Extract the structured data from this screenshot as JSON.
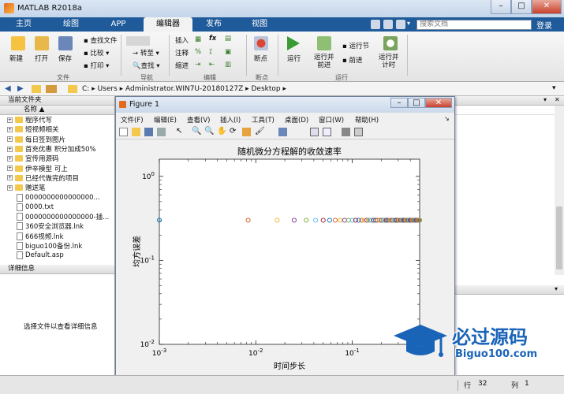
{
  "window": {
    "title": "MATLAB R2018a",
    "min": "–",
    "max": "□",
    "close": "✕"
  },
  "tabs": [
    "主页",
    "绘图",
    "APP",
    "编辑器",
    "发布",
    "视图"
  ],
  "search": {
    "placeholder": "搜索文档"
  },
  "login": "登录",
  "ribbon": {
    "file": {
      "new": "新建",
      "open": "打开",
      "save": "保存",
      "find_files": "查找文件",
      "compare": "比较",
      "print": "打印",
      "group": "文件"
    },
    "nav": {
      "goto": "转至",
      "find": "查找",
      "group": "导航"
    },
    "edit": {
      "insert": "插入",
      "comment": "注释",
      "indent": "缩进",
      "fx": "fx",
      "group": "编辑"
    },
    "breakpoints": {
      "label": "断点",
      "group": "断点"
    },
    "run": {
      "run": "运行",
      "run_advance": "运行并\n前进",
      "run_section": "运行节",
      "advance": "前进",
      "run_time": "运行并\n计时",
      "group": "运行"
    }
  },
  "address": {
    "parts": [
      "C:",
      "Users",
      "Administrator.WIN7U-20180127Z",
      "Desktop"
    ]
  },
  "left_pane": {
    "title": "当前文件夹",
    "column": "名称",
    "items": [
      {
        "name": "程序代写",
        "type": "folder"
      },
      {
        "name": "短视频相关",
        "type": "folder"
      },
      {
        "name": "每日签到图片",
        "type": "folder"
      },
      {
        "name": "首充优惠 积分加成50%",
        "type": "folder"
      },
      {
        "name": "宣传用源码",
        "type": "folder"
      },
      {
        "name": "伊辛模型 可上",
        "type": "folder"
      },
      {
        "name": "已经代做完的项目",
        "type": "folder"
      },
      {
        "name": "赠送笔",
        "type": "folder"
      },
      {
        "name": "0000000000000000...",
        "type": "file"
      },
      {
        "name": "0000.txt",
        "type": "file"
      },
      {
        "name": "0000000000000000-插...",
        "type": "file"
      },
      {
        "name": "360安全浏览器.lnk",
        "type": "file"
      },
      {
        "name": "666视频.lnk",
        "type": "file"
      },
      {
        "name": "biguo100备份.lnk",
        "type": "file"
      },
      {
        "name": "Default.asp",
        "type": "file"
      }
    ],
    "details_title": "详细信息",
    "details_text": "选择文件以查看详细信息"
  },
  "figure": {
    "title": "Figure 1",
    "menu": [
      "文件(F)",
      "编辑(E)",
      "查看(V)",
      "插入(I)",
      "工具(T)",
      "桌面(D)",
      "窗口(W)",
      "帮助(H)"
    ]
  },
  "status": {
    "line_label": "行",
    "line": "32",
    "col_label": "列",
    "col": "1"
  },
  "logo": {
    "text": "必过源码",
    "url": "Biguo100.com"
  },
  "chart_data": {
    "type": "scatter",
    "title": "随机微分方程解的收敛速率",
    "xlabel": "时间步长",
    "ylabel": "均方误差",
    "xscale": "log",
    "yscale": "log",
    "xlim": [
      0.001,
      0.5
    ],
    "ylim": [
      0.01,
      1.6
    ],
    "xticks": [
      "10^-3",
      "10^-2",
      "10^-1"
    ],
    "yticks": [
      "10^0",
      "10^-1",
      "10^-2"
    ],
    "y_value": 0.3,
    "x_start": 0.001,
    "x_end": 0.5,
    "n_points": 60,
    "colors": [
      "#0072bd",
      "#d95319",
      "#edb120",
      "#7e2f8e",
      "#77ac30",
      "#4dbeee",
      "#a2142f"
    ],
    "grid": false
  }
}
